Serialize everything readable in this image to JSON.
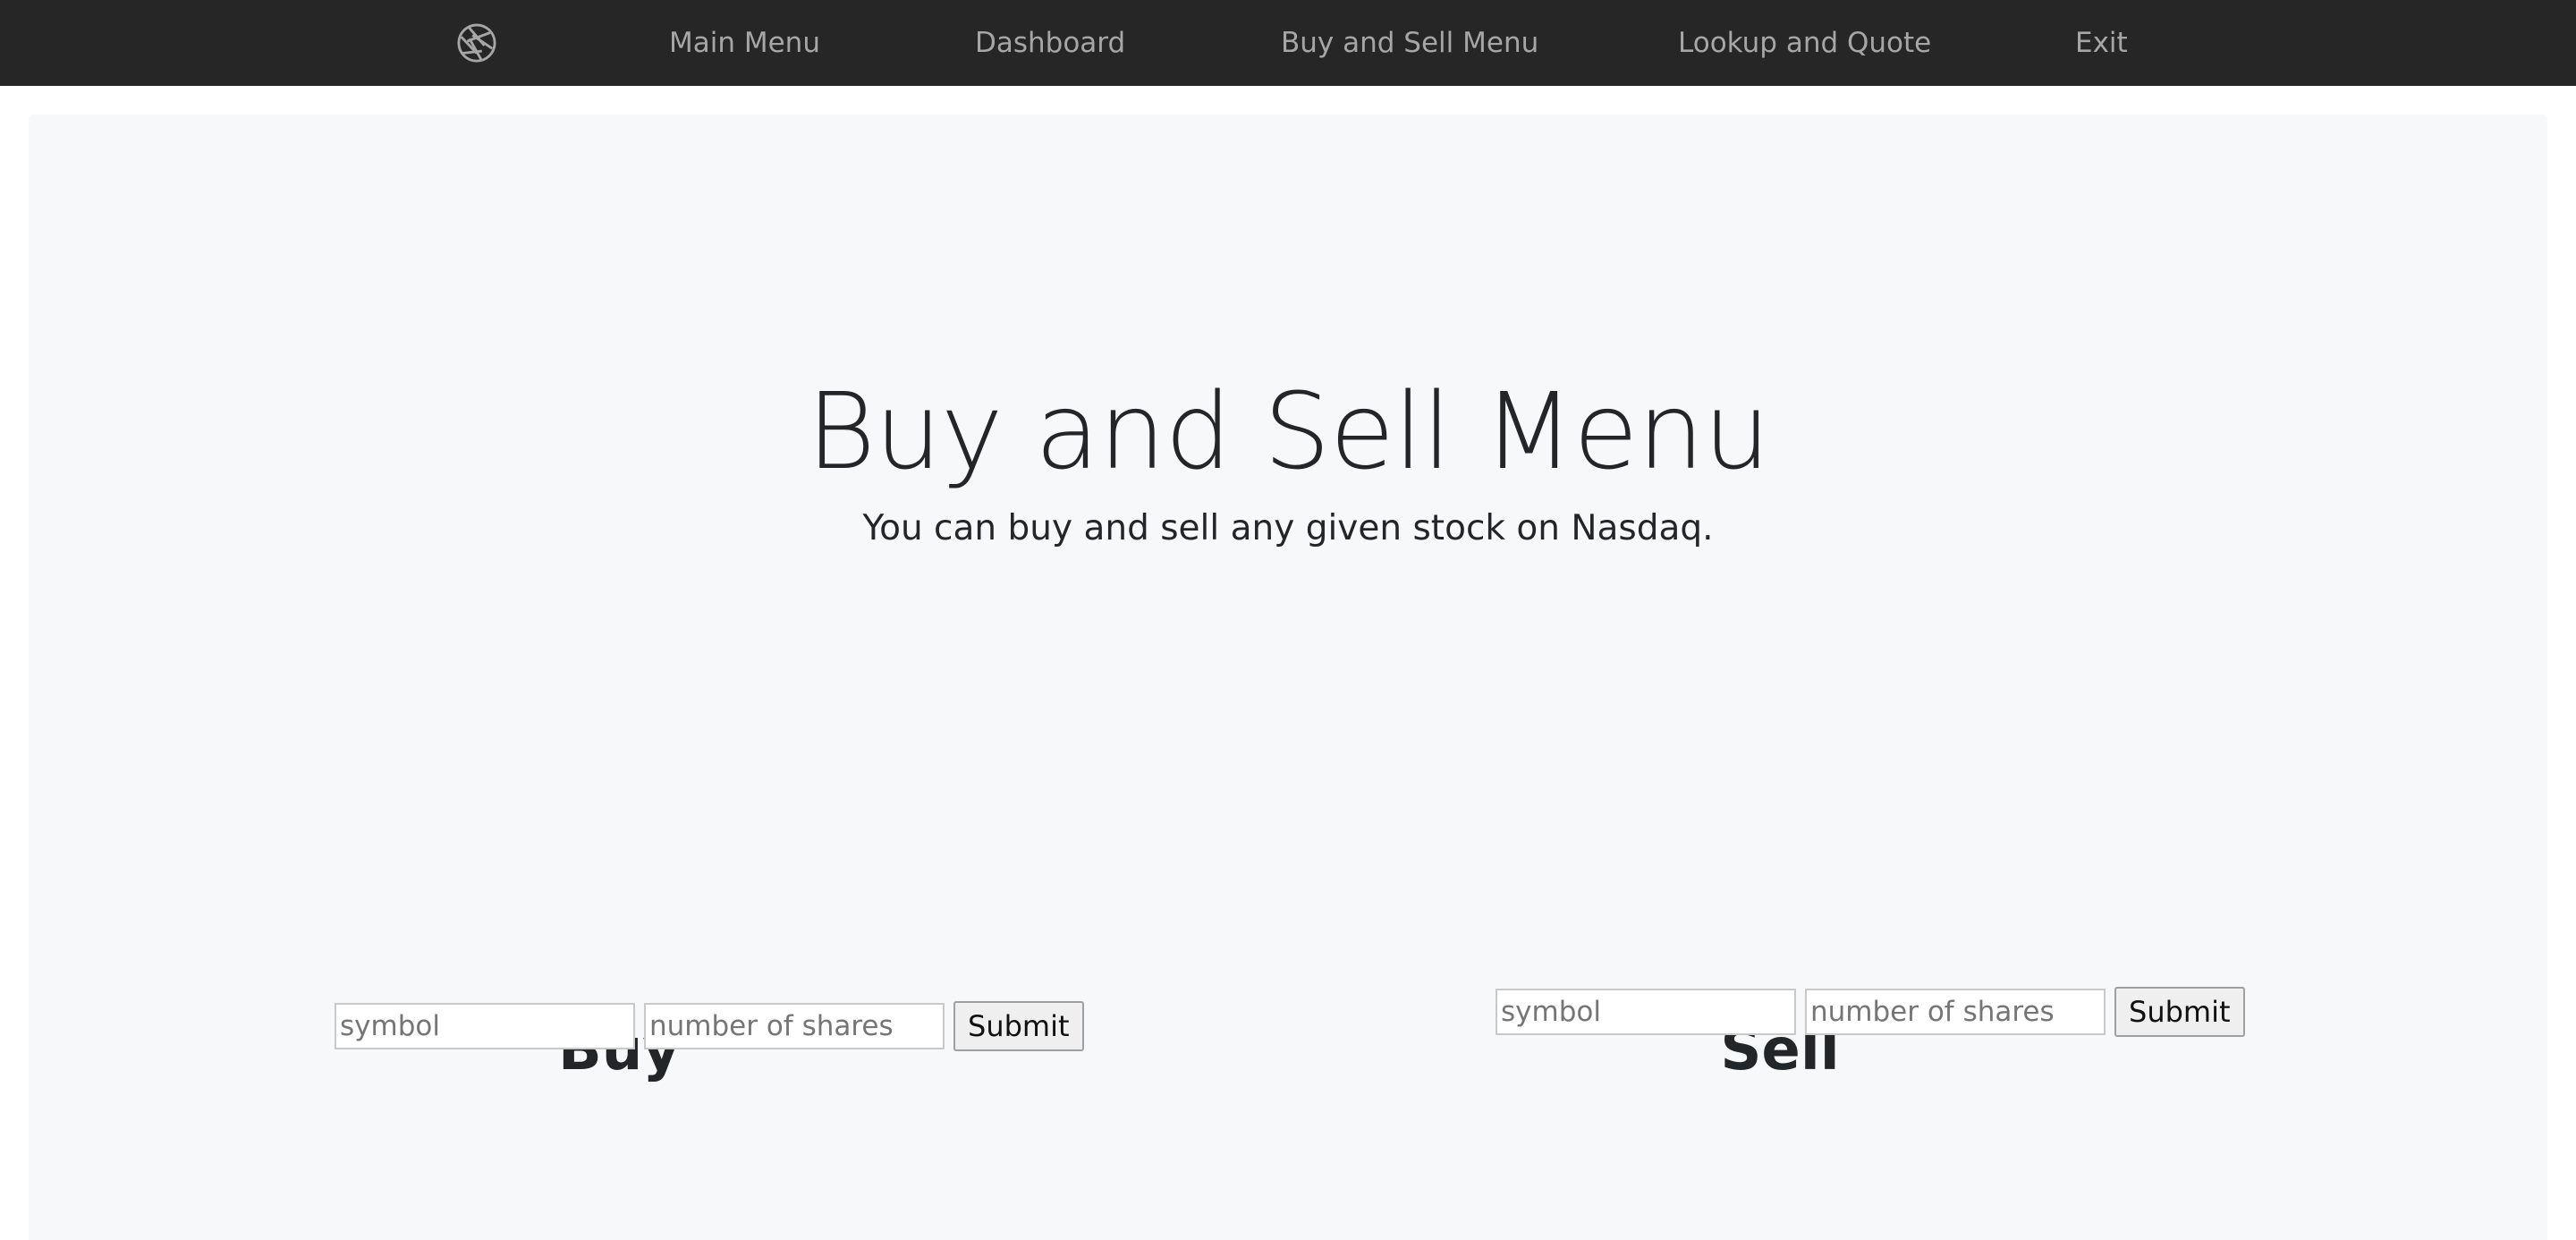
{
  "nav": {
    "logo_icon": "aperture-icon",
    "items": [
      {
        "label": "Main Menu"
      },
      {
        "label": "Dashboard"
      },
      {
        "label": "Buy and Sell Menu"
      },
      {
        "label": "Lookup and Quote"
      },
      {
        "label": "Exit"
      }
    ]
  },
  "hero": {
    "title": "Buy and Sell Menu",
    "subtitle": "You can buy and sell any given stock on Nasdaq."
  },
  "buy": {
    "title": "Buy",
    "symbol_placeholder": "symbol",
    "shares_placeholder": "number of shares",
    "submit_label": "Submit"
  },
  "sell": {
    "title": "Sell",
    "symbol_placeholder": "symbol",
    "shares_placeholder": "number of shares",
    "submit_label": "Submit"
  },
  "colors": {
    "navbar": "#262626",
    "nav_text": "#a6a6a6",
    "content_bg": "#f7f8f9",
    "heading": "#222629"
  }
}
